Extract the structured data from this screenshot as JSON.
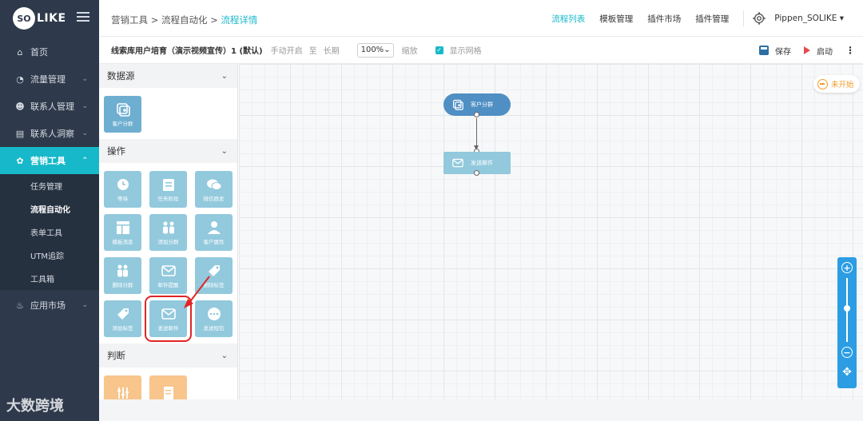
{
  "brand": {
    "badge": "SO",
    "text": "LIKE"
  },
  "sidebar": {
    "items": [
      {
        "label": "首页",
        "icon": "home-icon",
        "glyph": "⌂",
        "has_children": false
      },
      {
        "label": "流量管理",
        "icon": "pie-chart-icon",
        "glyph": "◔",
        "has_children": true
      },
      {
        "label": "联系人管理",
        "icon": "users-icon",
        "glyph": "☻",
        "has_children": true
      },
      {
        "label": "联系人洞察",
        "icon": "id-card-icon",
        "glyph": "▤",
        "has_children": true
      },
      {
        "label": "营销工具",
        "icon": "share-icon",
        "glyph": "✿",
        "has_children": true,
        "active": true
      },
      {
        "label": "应用市场",
        "icon": "cart-icon",
        "glyph": "♨",
        "has_children": true
      }
    ],
    "sub_items": [
      {
        "label": "任务管理"
      },
      {
        "label": "流程自动化",
        "active": true
      },
      {
        "label": "表单工具"
      },
      {
        "label": "UTM追踪"
      },
      {
        "label": "工具箱"
      }
    ]
  },
  "header": {
    "breadcrumb": [
      "营销工具",
      "流程自动化",
      "流程详情"
    ],
    "separator": ">",
    "nav": [
      {
        "label": "流程列表",
        "active": true
      },
      {
        "label": "模板管理"
      },
      {
        "label": "插件市场"
      },
      {
        "label": "插件管理"
      }
    ],
    "user": "Pippen_SOLIKE"
  },
  "toolbar": {
    "flow_name": "线索库用户培育（演示视频宣传）1 (默认)",
    "trigger": "手动开启",
    "to": "至",
    "duration": "长期",
    "zoom": "100%",
    "zoom_label": "缩放",
    "grid_label": "显示网格",
    "grid_checked": true,
    "save_label": "保存",
    "start_label": "启动"
  },
  "panel": {
    "sections": [
      {
        "title": "数据源",
        "tiles": [
          {
            "label": "客户分群",
            "icon": "segment-icon",
            "style": "dark"
          }
        ]
      },
      {
        "title": "操作",
        "tiles": [
          {
            "label": "等待",
            "icon": "clock-icon"
          },
          {
            "label": "任务阶段",
            "icon": "task-icon"
          },
          {
            "label": "微信群发",
            "icon": "wechat-icon"
          },
          {
            "label": "模板消息",
            "icon": "template-icon"
          },
          {
            "label": "添加分群",
            "icon": "add-group-icon"
          },
          {
            "label": "客户属性",
            "icon": "user-icon"
          },
          {
            "label": "删除分群",
            "icon": "remove-group-icon"
          },
          {
            "label": "邮件提醒",
            "icon": "mail-icon"
          },
          {
            "label": "删除标签",
            "icon": "tag-icon"
          },
          {
            "label": "添加标签",
            "icon": "tag-icon"
          },
          {
            "label": "发送邮件",
            "icon": "mail-icon",
            "highlighted": true
          },
          {
            "label": "发送短信",
            "icon": "sms-icon"
          }
        ]
      },
      {
        "title": "判断",
        "tiles": [
          {
            "label": "",
            "icon": "filter-icon",
            "style": "orange"
          },
          {
            "label": "",
            "icon": "form-icon",
            "style": "orange"
          }
        ]
      }
    ]
  },
  "canvas": {
    "nodes": [
      {
        "label": "客户分群"
      },
      {
        "label": "发送邮件"
      }
    ],
    "status": "未开始"
  },
  "watermark": "大数跨境",
  "colors": {
    "accent": "#17b8c9",
    "sidebar_bg": "#2e3a4b",
    "highlight": "#e02525",
    "status": "#f19a2a"
  }
}
